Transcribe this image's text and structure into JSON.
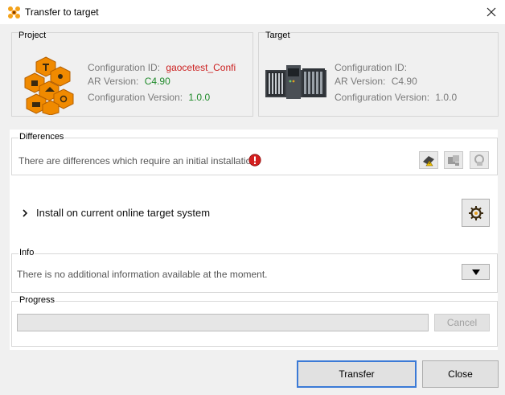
{
  "window": {
    "title": "Transfer to target"
  },
  "project": {
    "label": "Project",
    "config_id_label": "Configuration ID:",
    "config_id_value": "gaocetest_Confi",
    "ar_version_label": "AR Version:",
    "ar_version_value": "C4.90",
    "config_version_label": "Configuration Version:",
    "config_version_value": "1.0.0"
  },
  "target": {
    "label": "Target",
    "config_id_label": "Configuration ID:",
    "config_id_value": "",
    "ar_version_label": "AR Version:",
    "ar_version_value": "C4.90",
    "config_version_label": "Configuration Version:",
    "config_version_value": "1.0.0"
  },
  "differences": {
    "label": "Differences",
    "message": "There are differences which require an initial installation."
  },
  "install": {
    "label": "Install on current online target system"
  },
  "info": {
    "label": "Info",
    "message": "There is no additional information available at the moment."
  },
  "progress": {
    "label": "Progress",
    "value": 0,
    "cancel_label": "Cancel"
  },
  "buttons": {
    "transfer": "Transfer",
    "close": "Close"
  },
  "colors": {
    "accent": "#3b7ad6",
    "warning": "#d41f1f",
    "project_icon": "#f08a00"
  }
}
